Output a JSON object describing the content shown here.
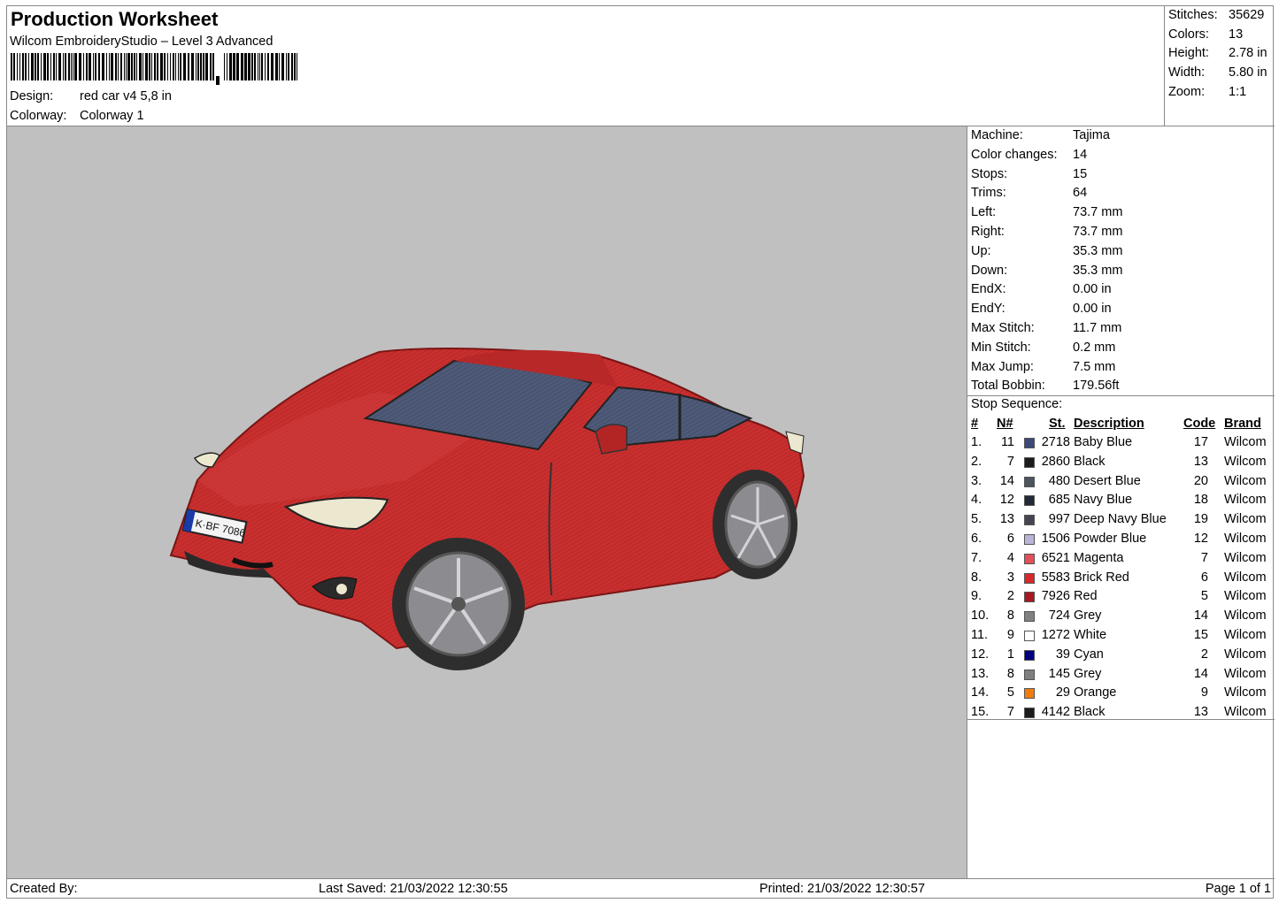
{
  "header": {
    "title": "Production Worksheet",
    "software": "Wilcom EmbroideryStudio – Level 3 Advanced",
    "design_label": "Design:",
    "design_value": "red car v4 5,8 in",
    "colorway_label": "Colorway:",
    "colorway_value": "Colorway 1"
  },
  "summary": {
    "stitches_label": "Stitches:",
    "stitches": "35629",
    "colors_label": "Colors:",
    "colors": "13",
    "height_label": "Height:",
    "height": "2.78 in",
    "width_label": "Width:",
    "width": "5.80 in",
    "zoom_label": "Zoom:",
    "zoom": "1:1"
  },
  "machine_info": [
    {
      "label": "Machine:",
      "value": "Tajima"
    },
    {
      "label": "Color changes:",
      "value": "14"
    },
    {
      "label": "Stops:",
      "value": "15"
    },
    {
      "label": "Trims:",
      "value": "64"
    },
    {
      "label": "Left:",
      "value": "73.7 mm"
    },
    {
      "label": "Right:",
      "value": "73.7 mm"
    },
    {
      "label": "Up:",
      "value": "35.3 mm"
    },
    {
      "label": "Down:",
      "value": "35.3 mm"
    },
    {
      "label": "EndX:",
      "value": "0.00 in"
    },
    {
      "label": "EndY:",
      "value": "0.00 in"
    },
    {
      "label": "Max Stitch:",
      "value": "11.7 mm"
    },
    {
      "label": "Min Stitch:",
      "value": "0.2 mm"
    },
    {
      "label": "Max Jump:",
      "value": "7.5 mm"
    },
    {
      "label": "Total Bobbin:",
      "value": "179.56ft"
    }
  ],
  "stop_sequence": {
    "title": "Stop Sequence:",
    "columns": {
      "num": "#",
      "needle": "N#",
      "stitches": "St.",
      "description": "Description",
      "code": "Code",
      "brand": "Brand"
    },
    "rows": [
      {
        "num": "1.",
        "needle": "11",
        "color": "#3b4a7a",
        "stitches": "2718",
        "description": "Baby Blue",
        "code": "17",
        "brand": "Wilcom"
      },
      {
        "num": "2.",
        "needle": "7",
        "color": "#1c1c1c",
        "stitches": "2860",
        "description": "Black",
        "code": "13",
        "brand": "Wilcom"
      },
      {
        "num": "3.",
        "needle": "14",
        "color": "#4a5560",
        "stitches": "480",
        "description": "Desert Blue",
        "code": "20",
        "brand": "Wilcom"
      },
      {
        "num": "4.",
        "needle": "12",
        "color": "#252a38",
        "stitches": "685",
        "description": "Navy Blue",
        "code": "18",
        "brand": "Wilcom"
      },
      {
        "num": "5.",
        "needle": "13",
        "color": "#454552",
        "stitches": "997",
        "description": "Deep Navy Blue",
        "code": "19",
        "brand": "Wilcom"
      },
      {
        "num": "6.",
        "needle": "6",
        "color": "#b9b4d8",
        "stitches": "1506",
        "description": "Powder Blue",
        "code": "12",
        "brand": "Wilcom"
      },
      {
        "num": "7.",
        "needle": "4",
        "color": "#e2505a",
        "stitches": "6521",
        "description": "Magenta",
        "code": "7",
        "brand": "Wilcom"
      },
      {
        "num": "8.",
        "needle": "3",
        "color": "#d8282c",
        "stitches": "5583",
        "description": "Brick Red",
        "code": "6",
        "brand": "Wilcom"
      },
      {
        "num": "9.",
        "needle": "2",
        "color": "#a81820",
        "stitches": "7926",
        "description": "Red",
        "code": "5",
        "brand": "Wilcom"
      },
      {
        "num": "10.",
        "needle": "8",
        "color": "#808080",
        "stitches": "724",
        "description": "Grey",
        "code": "14",
        "brand": "Wilcom"
      },
      {
        "num": "11.",
        "needle": "9",
        "color": "#ffffff",
        "stitches": "1272",
        "description": "White",
        "code": "15",
        "brand": "Wilcom"
      },
      {
        "num": "12.",
        "needle": "1",
        "color": "#000080",
        "stitches": "39",
        "description": "Cyan",
        "code": "2",
        "brand": "Wilcom"
      },
      {
        "num": "13.",
        "needle": "8",
        "color": "#808080",
        "stitches": "145",
        "description": "Grey",
        "code": "14",
        "brand": "Wilcom"
      },
      {
        "num": "14.",
        "needle": "5",
        "color": "#f07c10",
        "stitches": "29",
        "description": "Orange",
        "code": "9",
        "brand": "Wilcom"
      },
      {
        "num": "15.",
        "needle": "7",
        "color": "#1c1c1c",
        "stitches": "4142",
        "description": "Black",
        "code": "13",
        "brand": "Wilcom"
      }
    ]
  },
  "preview": {
    "plate_text": "K·BF 7086"
  },
  "footer": {
    "created_by": "Created By:",
    "last_saved": "Last Saved: 21/03/2022 12:30:55",
    "printed": "Printed: 21/03/2022 12:30:57",
    "page": "Page 1 of 1"
  }
}
